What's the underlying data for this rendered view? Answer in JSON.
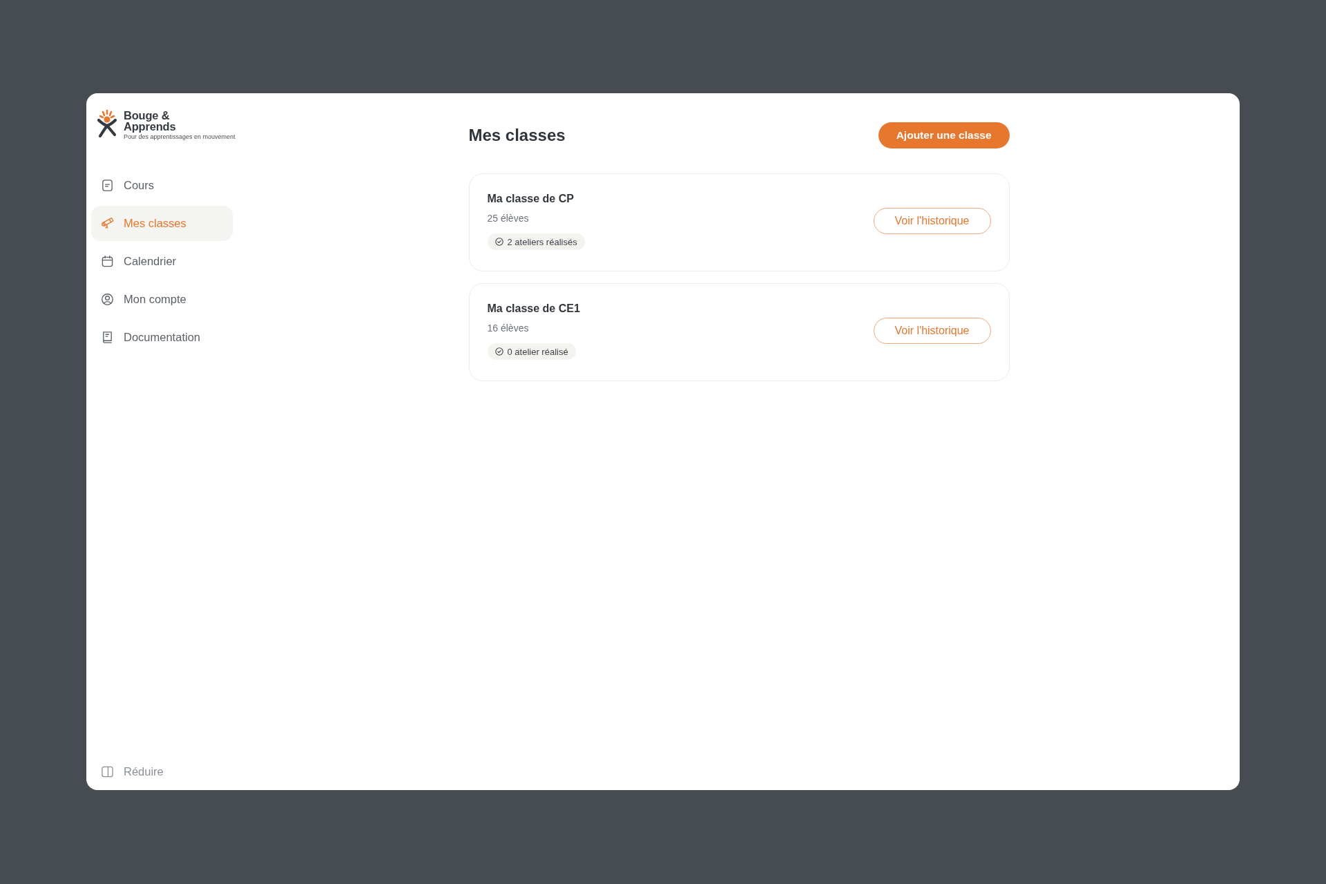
{
  "brand": {
    "name": [
      "Bouge &",
      "Apprends"
    ],
    "tagline": "Pour des apprentissages en mouvement"
  },
  "sidebar": {
    "items": [
      {
        "label": "Cours",
        "selected": false
      },
      {
        "label": "Mes classes",
        "selected": true
      },
      {
        "label": "Calendrier",
        "selected": false
      },
      {
        "label": "Mon compte",
        "selected": false
      },
      {
        "label": "Documentation",
        "selected": false
      }
    ],
    "collapse": {
      "label": "Réduire"
    }
  },
  "page": {
    "title": "Mes classes",
    "add_button": "Ajouter une classe"
  },
  "classes": [
    {
      "name": "Ma classe de CP",
      "students": "25 élèves",
      "workshops": "2 ateliers réalisés",
      "history_button": "Voir l'historique"
    },
    {
      "name": "Ma classe de CE1",
      "students": "16 élèves",
      "workshops": "0 atelier réalisé",
      "history_button": "Voir l'historique"
    }
  ]
}
